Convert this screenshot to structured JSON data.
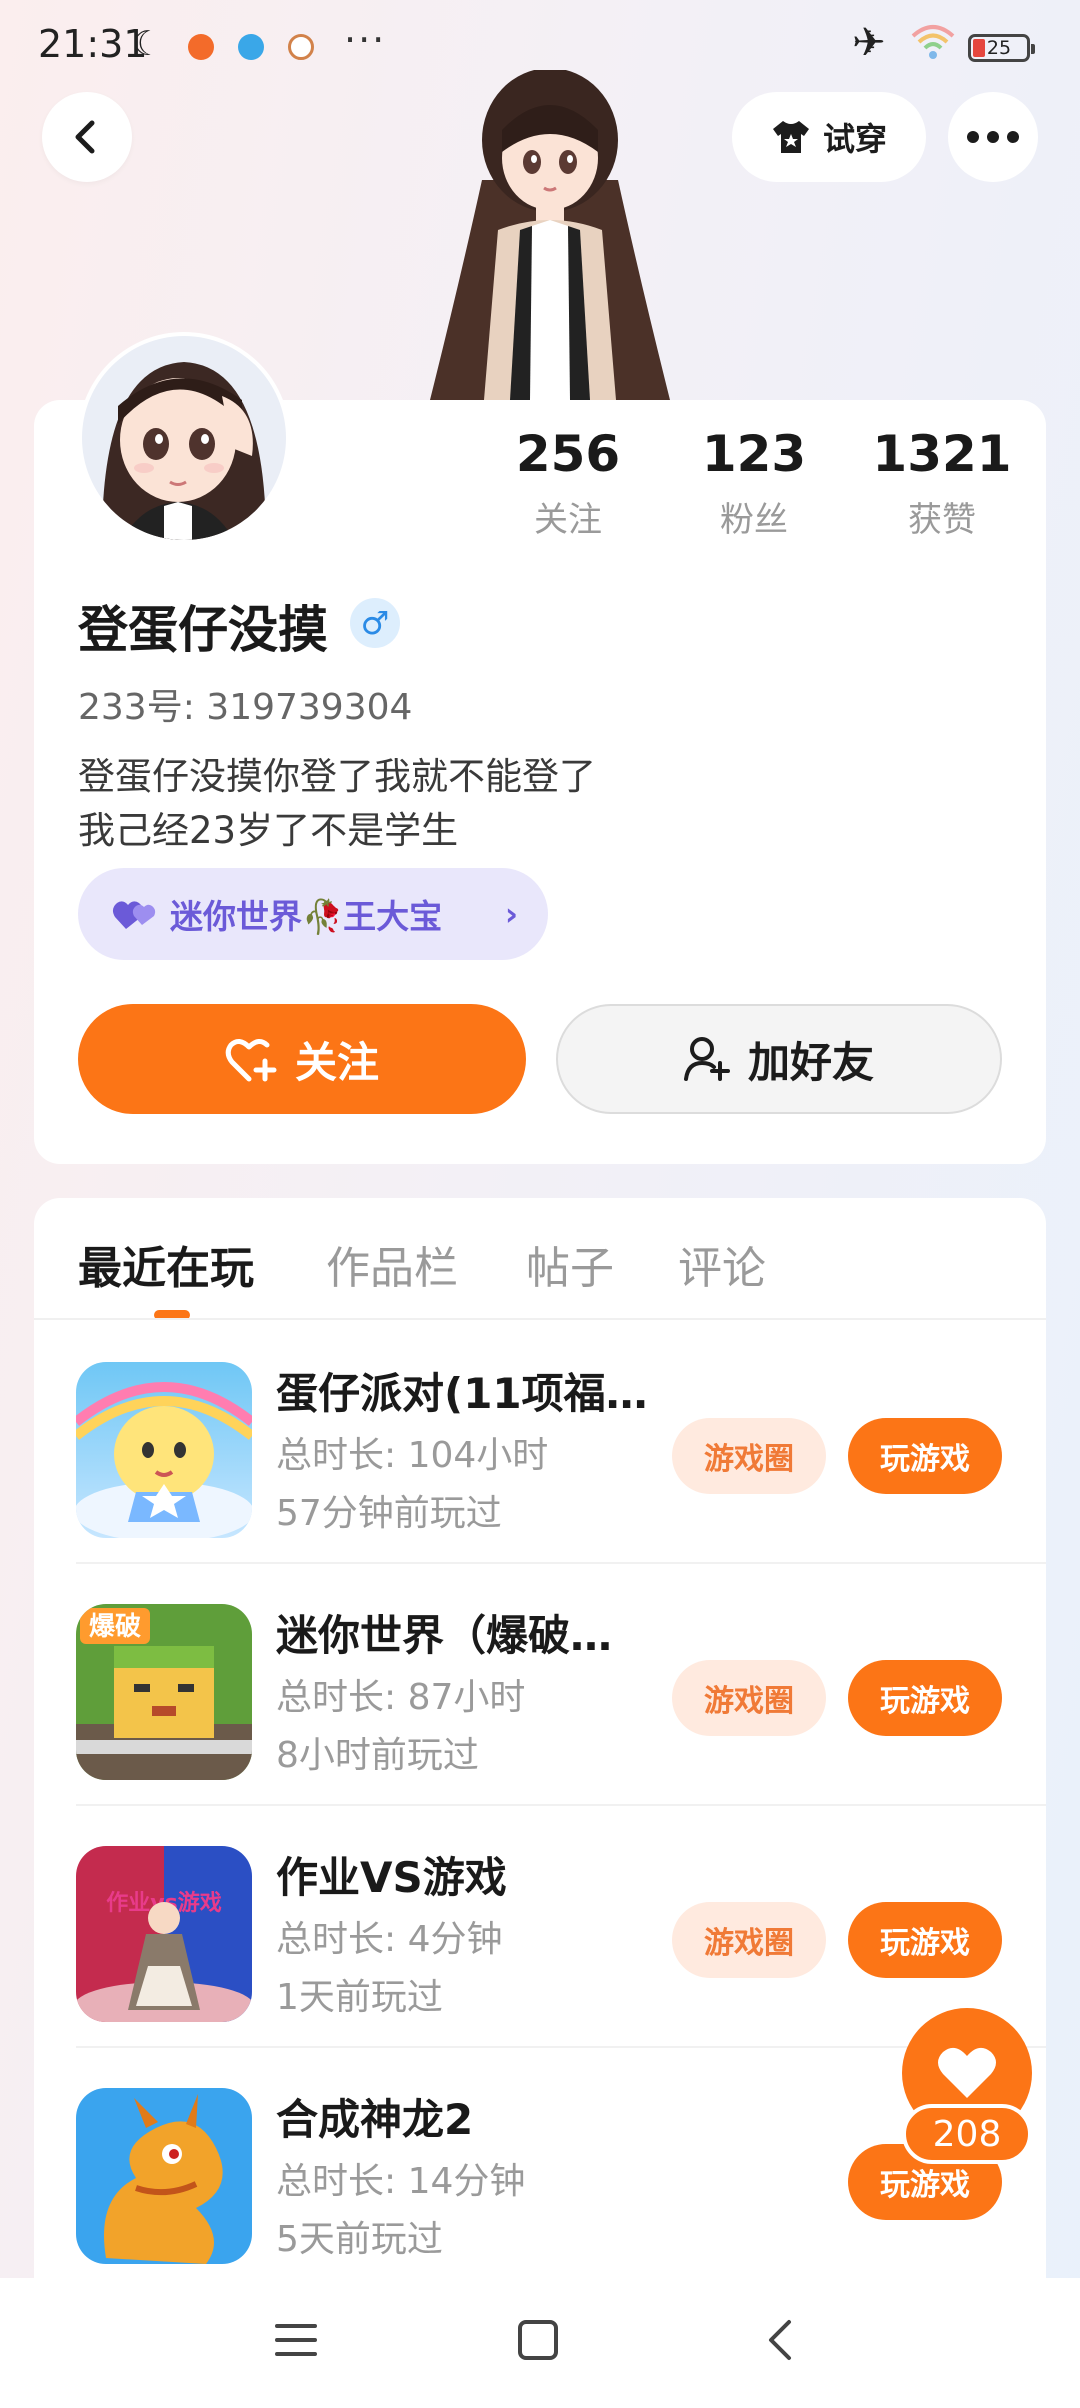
{
  "status_bar": {
    "time": "21:31",
    "more": "···",
    "battery": "25"
  },
  "header": {
    "tryon_label": "试穿"
  },
  "profile": {
    "stats": [
      {
        "value": "256",
        "label": "关注"
      },
      {
        "value": "123",
        "label": "粉丝"
      },
      {
        "value": "1321",
        "label": "获赞"
      }
    ],
    "nickname": "登蛋仔没摸",
    "gender_symbol": "♂",
    "uid": "233号: 319739304",
    "bio_lines": [
      "登蛋仔没摸你登了我就不能登了",
      "我己经23岁了不是学生"
    ],
    "bond_tag": {
      "text": "迷你世界🥀王大宝"
    },
    "follow_label": "关注",
    "add_friend_label": "加好友"
  },
  "tabs": [
    {
      "label": "最近在玩",
      "active": true
    },
    {
      "label": "作品栏",
      "active": false
    },
    {
      "label": "帖子",
      "active": false
    },
    {
      "label": "评论",
      "active": false
    }
  ],
  "games": [
    {
      "title": "蛋仔派对(11项福…",
      "duration": "总时长: 104小时",
      "last_played": "57分钟前玩过",
      "circle_label": "游戏圈",
      "play_label": "玩游戏",
      "icon": "eggy-party-icon"
    },
    {
      "title": "迷你世界（爆破…",
      "duration": "总时长: 87小时",
      "last_played": "8小时前玩过",
      "circle_label": "游戏圈",
      "play_label": "玩游戏",
      "icon": "mini-world-icon",
      "icon_badge": "爆破"
    },
    {
      "title": "作业VS游戏",
      "duration": "总时长: 4分钟",
      "last_played": "1天前玩过",
      "circle_label": "游戏圈",
      "play_label": "玩游戏",
      "icon": "homework-vs-game-icon",
      "icon_badge": "作业vs游戏"
    },
    {
      "title": "合成神龙2",
      "duration": "总时长: 14分钟",
      "last_played": "5天前玩过",
      "play_label": "玩游戏",
      "icon": "dragon-icon"
    }
  ],
  "like_fab": {
    "count": "208"
  }
}
